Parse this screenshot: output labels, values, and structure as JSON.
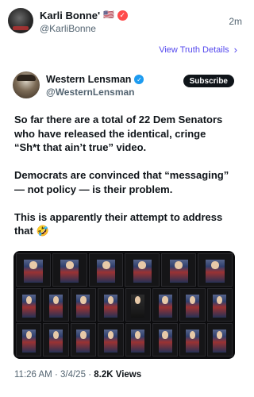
{
  "post": {
    "author_name": "Karli Bonne'",
    "author_flag": "🇺🇸",
    "author_handle": "@KarliBonne",
    "time_ago": "2m",
    "view_details_label": "View Truth Details"
  },
  "tweet": {
    "author_name": "Western Lensman",
    "author_handle": "@WesternLensman",
    "subscribe_label": "Subscribe",
    "paragraphs": [
      "So far there are a total of 22 Dem Senators who have released the identical, cringe “Sh*t that ain’t true” video.",
      "Democrats are convinced that “messaging” — not policy — is their problem.",
      "This is apparently their attempt to address that"
    ],
    "emoji": "🤣",
    "time": "11:26 AM",
    "date": "3/4/25",
    "views_count": "8.2K",
    "views_label": "Views",
    "separator": "·"
  },
  "media": {
    "grid_rows": 3,
    "grid_cols": 8
  }
}
